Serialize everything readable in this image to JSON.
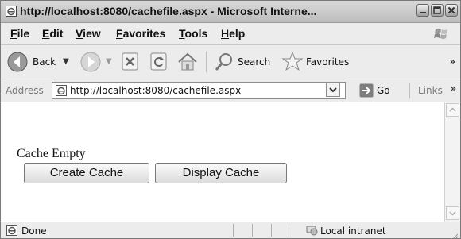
{
  "window": {
    "title": "http://localhost:8080/cachefile.aspx - Microsoft Interne..."
  },
  "menu": {
    "items": [
      "File",
      "Edit",
      "View",
      "Favorites",
      "Tools",
      "Help"
    ]
  },
  "toolbar": {
    "back_label": "Back",
    "search_label": "Search",
    "favorites_label": "Favorites",
    "chevron": "»"
  },
  "address": {
    "label": "Address",
    "url": "http://localhost:8080/cachefile.aspx",
    "go_label": "Go",
    "links_label": "Links",
    "links_chevron": "»"
  },
  "page": {
    "status_text": "Cache Empty",
    "create_button": "Create Cache",
    "display_button": "Display Cache"
  },
  "statusbar": {
    "text": "Done",
    "zone": "Local intranet"
  },
  "icons": {
    "title": "ie-page-icon",
    "minimize": "minimize-icon",
    "maximize": "maximize-icon",
    "close": "close-icon",
    "back": "back-arrow-icon",
    "forward": "forward-arrow-icon",
    "stop": "stop-icon",
    "refresh": "refresh-icon",
    "home": "home-icon",
    "search": "search-icon",
    "favorites": "favorites-star-icon",
    "go": "go-arrow-icon"
  }
}
